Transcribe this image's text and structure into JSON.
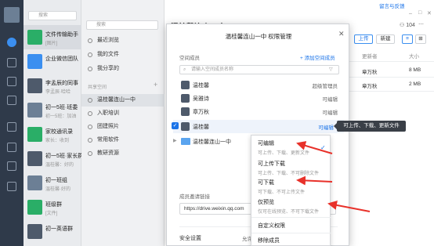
{
  "top_link": "留言与反馈",
  "chat_search_placeholder": "搜索",
  "chats": [
    {
      "name": "文件传输助手",
      "preview": "[图片]",
      "color": "#2aae67"
    },
    {
      "name": "企业微信团队",
      "preview": "",
      "color": "#3b8ff0"
    },
    {
      "name": "李孟辰的同事",
      "preview": "李孟辰·哈哈",
      "color": "#4e5a6b"
    },
    {
      "name": "初一5班·班委",
      "preview": "初一5班：加油",
      "color": "#6c7f95"
    },
    {
      "name": "家校通讯录",
      "preview": "家长：收到",
      "color": "#2aae67"
    },
    {
      "name": "初一5班·家长群",
      "preview": "温桂馨：好的",
      "color": "#4e5a6b"
    },
    {
      "name": "初一班组",
      "preview": "温桂馨·好的",
      "color": "#6c7f95"
    },
    {
      "name": "班级群",
      "preview": "[文件]",
      "color": "#2aae67"
    },
    {
      "name": "初一英语群",
      "preview": "",
      "color": "#4e5a6b"
    }
  ],
  "file_sidebar": {
    "search_placeholder": "搜索",
    "items": [
      "最近浏览",
      "我的文件",
      "我分享的"
    ],
    "section_label": "共享空间",
    "spaces": [
      "温桂馨连山一中",
      "入职培训",
      "团建照片",
      "常用软件",
      "教研资源"
    ]
  },
  "main": {
    "title": "温桂馨连山一中",
    "member_count": "104",
    "upload_button": "上传",
    "new_button": "新建",
    "col_updater": "更新者",
    "col_size": "大小",
    "rows": [
      {
        "updater": "章万秋",
        "size": "8 MB"
      },
      {
        "updater": "章万秋",
        "size": "2 MB"
      }
    ]
  },
  "modal": {
    "title": "温桂馨连山一中 权限管理",
    "members_label": "空间成员",
    "add_member_link": "+ 添加空间成员",
    "search_placeholder": "请输入空间成员名称",
    "members": [
      {
        "name": "温桂馨",
        "permission": "超级管理员"
      },
      {
        "name": "吴雅诗",
        "permission": "可编辑"
      },
      {
        "name": "章万秋",
        "permission": "可编辑"
      },
      {
        "name": "温桂馨",
        "permission": "可编辑 ▾"
      }
    ],
    "subgroup": {
      "name": "温桂馨连山一中",
      "permission": "可编辑"
    },
    "invite_label": "成员邀请链接",
    "invite_link": "https://drive.weixin.qq.com",
    "security_label": "安全设置",
    "security_value": "允许"
  },
  "dropdown": {
    "options": [
      {
        "title": "可编辑",
        "desc": "可上传、下载、更新文件"
      },
      {
        "title": "可上传下载",
        "desc": "可上传、下载、不可删除文件"
      },
      {
        "title": "可下载",
        "desc": "可下载、不可上传文件"
      },
      {
        "title": "仅预览",
        "desc": "仅可在线预览、不可下载文件"
      }
    ],
    "custom": "自定义权限",
    "remove": "移除成员"
  },
  "tooltip": "可上传、下载、更新文件"
}
